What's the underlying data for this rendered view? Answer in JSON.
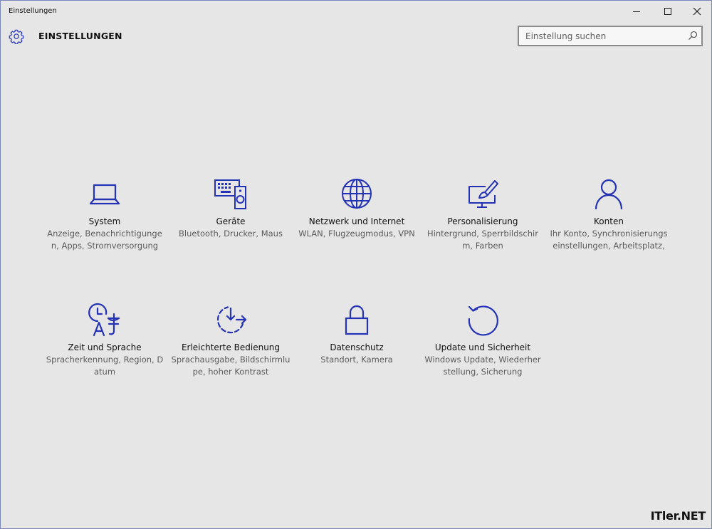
{
  "window": {
    "title": "Einstellungen",
    "controls": {
      "minimize": "minimize-icon",
      "maximize": "maximize-icon",
      "close": "close-icon"
    }
  },
  "header": {
    "title": "EINSTELLUNGEN",
    "icon": "gear-icon"
  },
  "search": {
    "value": "",
    "placeholder": "Einstellung suchen",
    "icon": "search-icon"
  },
  "accent_color": "#2432b5",
  "tiles": [
    {
      "label": "System",
      "description": "Anzeige, Benachrichtigungen, Apps, Stromversorgung",
      "icon": "laptop-icon"
    },
    {
      "label": "Geräte",
      "description": "Bluetooth, Drucker, Maus",
      "icon": "devices-icon"
    },
    {
      "label": "Netzwerk und Internet",
      "description": "WLAN, Flugzeugmodus, VPN",
      "icon": "globe-icon"
    },
    {
      "label": "Personalisierung",
      "description": "Hintergrund, Sperrbildschirm, Farben",
      "icon": "paint-icon"
    },
    {
      "label": "Konten",
      "description": "Ihr Konto, Synchronisierungseinstellungen, Arbeitsplatz,",
      "icon": "person-icon"
    },
    {
      "label": "Zeit und Sprache",
      "description": "Spracherkennung, Region, Datum",
      "icon": "time-language-icon"
    },
    {
      "label": "Erleichterte Bedienung",
      "description": "Sprachausgabe, Bildschirmlupe, hoher Kontrast",
      "icon": "ease-of-access-icon"
    },
    {
      "label": "Datenschutz",
      "description": "Standort, Kamera",
      "icon": "lock-icon"
    },
    {
      "label": "Update und Sicherheit",
      "description": "Windows Update, Wiederherstellung, Sicherung",
      "icon": "update-icon"
    }
  ],
  "watermark": "ITler.NET"
}
